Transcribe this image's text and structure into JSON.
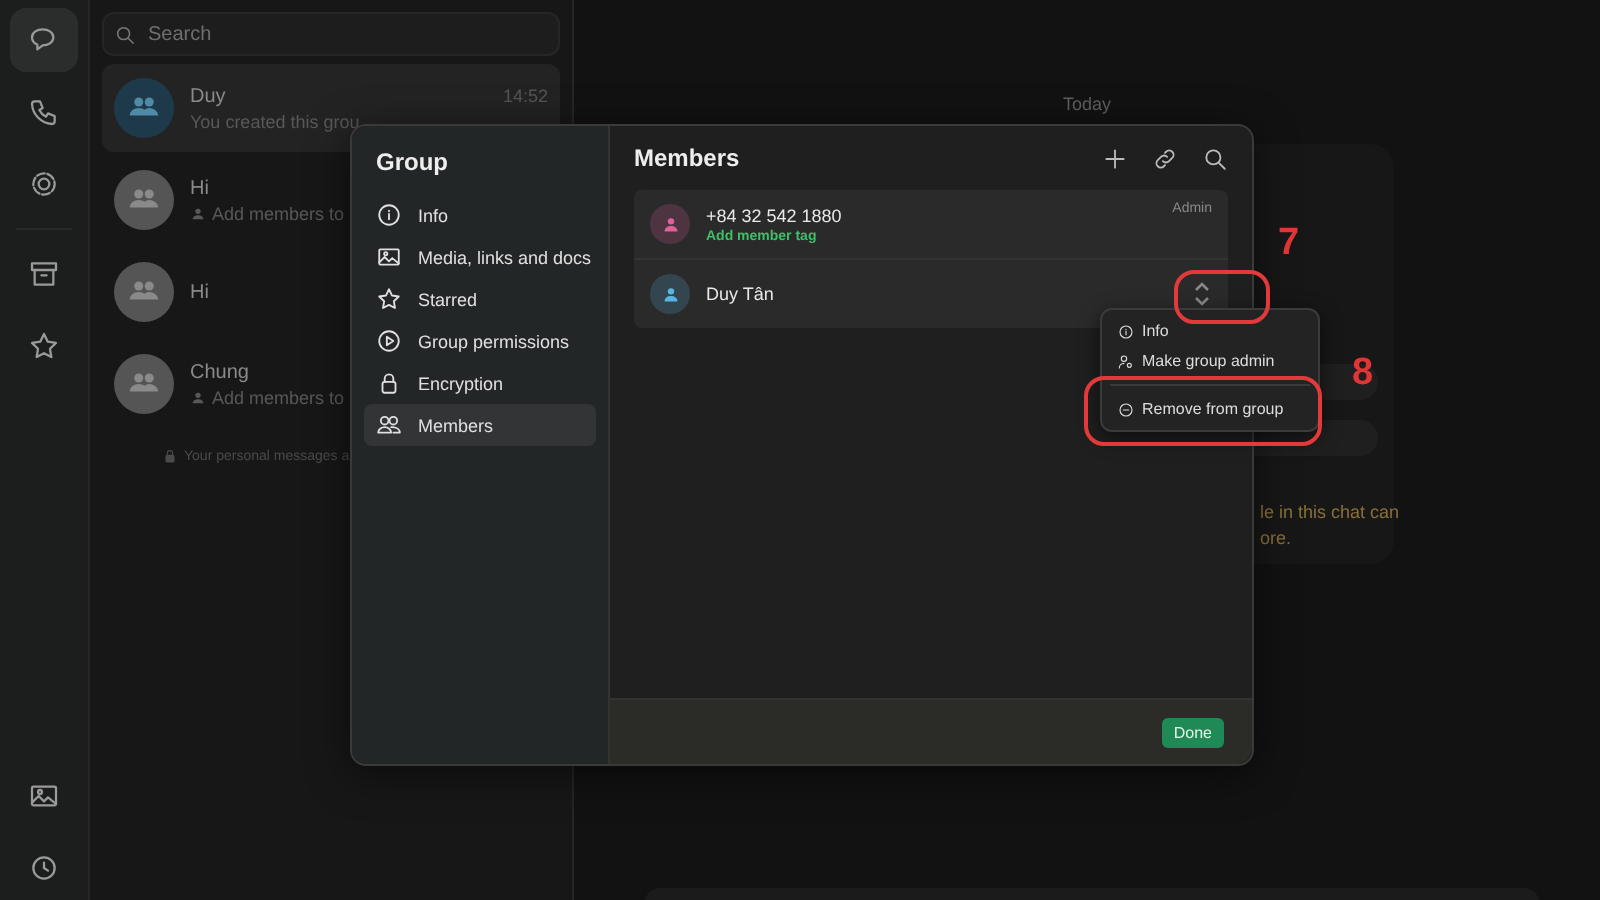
{
  "rail": {
    "items": [
      {
        "kind": "chats",
        "selected": true
      },
      {
        "kind": "calls",
        "selected": false
      },
      {
        "kind": "status",
        "selected": false
      },
      {
        "kind": "archive",
        "selected": false
      },
      {
        "kind": "starred",
        "selected": false
      }
    ],
    "bottom": [
      {
        "kind": "media"
      },
      {
        "kind": "settings"
      }
    ]
  },
  "chat_list": {
    "search": {
      "placeholder": "Search"
    },
    "chats": [
      {
        "name": "Duy",
        "preview": "You created this grou",
        "time": "14:52",
        "kind": "created",
        "color": "#1e3a4a",
        "selected": true
      },
      {
        "name": "Hi",
        "preview": "Add members to",
        "kind": "invite",
        "color": "#555555",
        "selected": false
      },
      {
        "name": "Hi",
        "kind": "empty",
        "color": "#555555",
        "selected": false
      },
      {
        "name": "Chung",
        "preview": "Add members to",
        "kind": "invite",
        "color": "#555555",
        "selected": false
      }
    ],
    "footer_note": "Your personal messages a"
  },
  "chat": {
    "date": "Today",
    "notice": [
      "le in this chat can",
      "ore."
    ]
  },
  "modal": {
    "title": "Group",
    "nav": [
      {
        "label": "Info",
        "kind": "info",
        "selected": false
      },
      {
        "label": "Media, links and docs",
        "kind": "media",
        "selected": false
      },
      {
        "label": "Starred",
        "kind": "star",
        "selected": false
      },
      {
        "label": "Group permissions",
        "kind": "permissions",
        "selected": false
      },
      {
        "label": "Encryption",
        "kind": "lock",
        "selected": false
      },
      {
        "label": "Members",
        "kind": "members",
        "selected": true
      }
    ],
    "panel_title": "Members",
    "tools": [
      {
        "kind": "add"
      },
      {
        "kind": "link"
      },
      {
        "kind": "search"
      }
    ],
    "members": [
      {
        "name": "+84 32 542 1880",
        "tag": "Add member tag",
        "role": "Admin",
        "color": "#e0609a",
        "menu_open": false
      },
      {
        "name": "Duy Tân",
        "color": "#5ab4e0",
        "menu_open": true
      }
    ],
    "menu": [
      {
        "label": "Info",
        "kind": "info"
      },
      {
        "label": "Make group admin",
        "kind": "admin"
      },
      {
        "label": "Remove from group",
        "kind": "remove"
      }
    ],
    "done": "Done"
  },
  "annotations": [
    {
      "label": "7"
    },
    {
      "label": "8"
    }
  ]
}
